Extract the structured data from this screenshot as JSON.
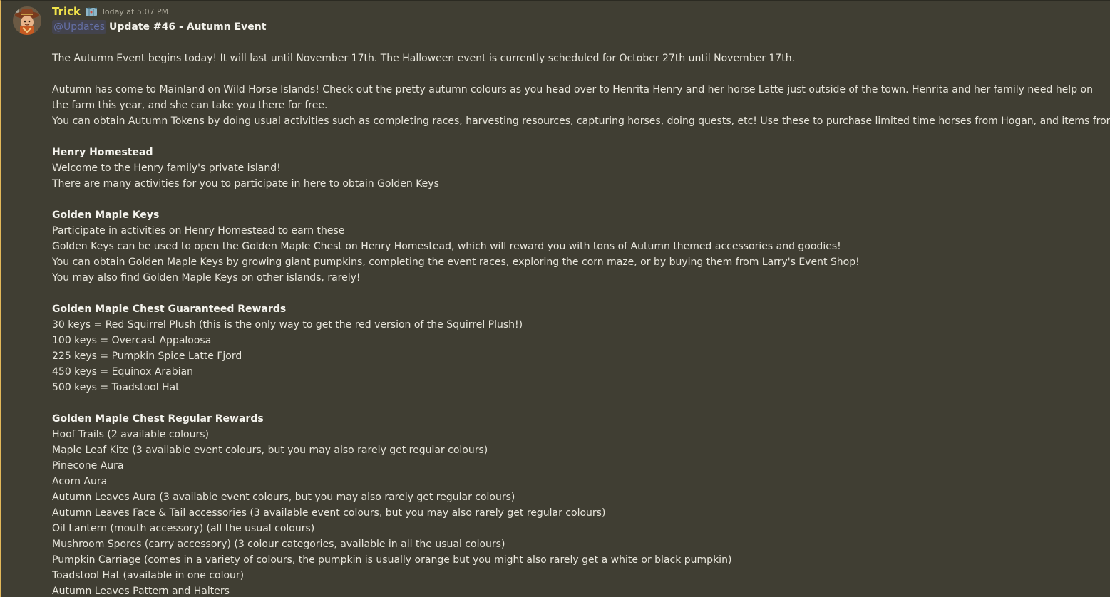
{
  "message": {
    "author": "Trick",
    "timestamp": "Today at 5:07 PM",
    "mention": "@Updates",
    "title": "Update #46 - Autumn Event",
    "intro": "The Autumn Event begins today! It will last until November 17th. The Halloween event is currently scheduled for October 27th until November 17th.",
    "para1": "Autumn has come to Mainland on Wild Horse Islands! Check out the pretty autumn colours as you head over to Henrita Henry and her horse Latte just outside of the town. Henrita and her family need help on the farm this year, and she can take you there for free.",
    "para2": "You can obtain Autumn Tokens by doing usual activities such as completing races, harvesting resources, capturing horses, doing quests, etc! Use these to purchase limited time horses from Hogan, and items from Larry.",
    "homestead": {
      "heading": "Henry Homestead",
      "lines": [
        "Welcome to the Henry family's private island!",
        "There are many activities for you to participate in here to obtain Golden Keys"
      ]
    },
    "keys": {
      "heading": "Golden Maple Keys",
      "lines": [
        "Participate in activities on Henry Homestead to earn these",
        "Golden Keys can be used to open the Golden Maple Chest on Henry Homestead, which will reward you with tons of Autumn themed accessories and goodies!",
        "You can obtain Golden Maple Keys by growing giant pumpkins, completing the event races, exploring the corn maze, or by buying them from Larry's Event Shop!",
        "You may also find Golden Maple Keys on other islands, rarely!"
      ]
    },
    "guaranteed": {
      "heading": "Golden Maple Chest Guaranteed Rewards",
      "lines": [
        "30 keys = Red Squirrel Plush (this is the only way to get the red version of the Squirrel Plush!)",
        "100 keys = Overcast Appaloosa",
        "225 keys = Pumpkin Spice Latte Fjord",
        "450 keys = Equinox Arabian",
        "500 keys = Toadstool Hat"
      ]
    },
    "regular": {
      "heading": "Golden Maple Chest Regular Rewards",
      "lines": [
        "Hoof Trails (2 available colours)",
        "Maple Leaf Kite (3 available event colours, but you may also rarely get regular colours)",
        "Pinecone Aura",
        "Acorn Aura",
        "Autumn Leaves Aura (3 available event colours, but you may also rarely get regular colours)",
        "Autumn Leaves Face & Tail accessories (3 available event colours, but you may also rarely get regular colours)",
        "Oil Lantern (mouth accessory) (all the usual colours)",
        "Mushroom Spores (carry accessory) (3 colour categories, available in all the usual colours)",
        "Pumpkin Carriage (comes in a variety of colours, the pumpkin is usually orange but you might also rarely get a white or black pumpkin)",
        "Toadstool Hat (available in one colour)",
        "Autumn Leaves Pattern and Halters"
      ]
    }
  },
  "icons": {
    "avatar": "cowboy-avatar-icon",
    "badge": "map-badge-icon"
  },
  "colors": {
    "background": "#403e33",
    "username": "#f0e34a",
    "text": "#e8e6dc",
    "mention": "#6f7fc9",
    "accent_bar": "#e3b85a"
  }
}
